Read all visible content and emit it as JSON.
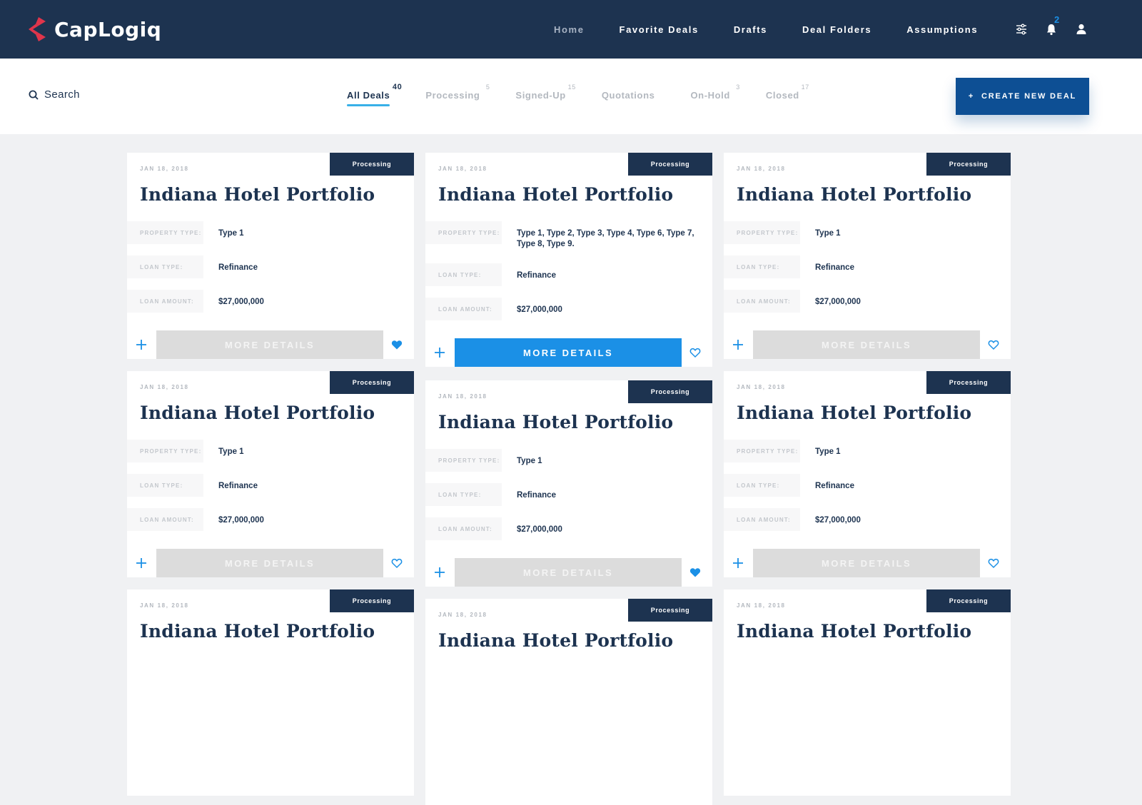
{
  "brand": {
    "name": "CapLogiq"
  },
  "colors": {
    "nav_bg": "#1d3350",
    "accent_blue": "#1b90e6",
    "button_dark_blue": "#0d4f94",
    "logo_red": "#e0354b",
    "disabled_button": "#dcdcdc"
  },
  "nav": {
    "links": [
      "Home",
      "Favorite Deals",
      "Drafts",
      "Deal Folders",
      "Assumptions"
    ],
    "notification_count": "2",
    "icons": [
      "filter-sliders-icon",
      "bell-icon",
      "user-icon"
    ]
  },
  "search": {
    "label": "Search"
  },
  "tabs": [
    {
      "label": "All Deals",
      "count": "40",
      "active": true
    },
    {
      "label": "Processing",
      "count": "5"
    },
    {
      "label": "Signed-Up",
      "count": "15"
    },
    {
      "label": "Quotations",
      "count": ""
    },
    {
      "label": "On-Hold",
      "count": "3"
    },
    {
      "label": "Closed",
      "count": "17"
    }
  ],
  "create_button": {
    "icon": "+",
    "label": "CREATE NEW DEAL"
  },
  "card_labels": {
    "property_type": "PROPERTY TYPE:",
    "loan_type": "LOAN TYPE:",
    "loan_amount": "LOAN AMOUNT:",
    "more_details": "MORE DETAILS"
  },
  "cards": [
    {
      "date": "JAN 18, 2018",
      "status": "Processing",
      "title": "Indiana Hotel Portfolio",
      "property_type": "Type 1",
      "loan_type": "Refinance",
      "loan_amount": "$27,000,000",
      "favorite": true,
      "highlighted": false
    },
    {
      "date": "JAN 18, 2018",
      "status": "Processing",
      "title": "Indiana Hotel Portfolio",
      "property_type": "Type 1, Type 2, Type 3, Type 4, Type 6, Type 7, Type 8, Type 9.",
      "loan_type": "Refinance",
      "loan_amount": "$27,000,000",
      "favorite": false,
      "highlighted": true
    },
    {
      "date": "JAN 18, 2018",
      "status": "Processing",
      "title": "Indiana Hotel Portfolio",
      "property_type": "Type 1",
      "loan_type": "Refinance",
      "loan_amount": "$27,000,000",
      "favorite": false,
      "highlighted": false
    },
    {
      "date": "JAN 18, 2018",
      "status": "Processing",
      "title": "Indiana Hotel Portfolio",
      "property_type": "Type 1",
      "loan_type": "Refinance",
      "loan_amount": "$27,000,000",
      "favorite": false,
      "highlighted": false
    },
    {
      "date": "JAN 18, 2018",
      "status": "Processing",
      "title": "Indiana Hotel Portfolio",
      "property_type": "Type 1",
      "loan_type": "Refinance",
      "loan_amount": "$27,000,000",
      "favorite": true,
      "highlighted": false
    },
    {
      "date": "JAN 18, 2018",
      "status": "Processing",
      "title": "Indiana Hotel Portfolio",
      "property_type": "Type 1",
      "loan_type": "Refinance",
      "loan_amount": "$27,000,000",
      "favorite": false,
      "highlighted": false
    },
    {
      "date": "JAN 18, 2018",
      "status": "Processing",
      "title": "Indiana Hotel Portfolio"
    },
    {
      "date": "JAN 18, 2018",
      "status": "Processing",
      "title": "Indiana Hotel Portfolio"
    },
    {
      "date": "JAN 18, 2018",
      "status": "Processing",
      "title": "Indiana Hotel Portfolio"
    }
  ]
}
